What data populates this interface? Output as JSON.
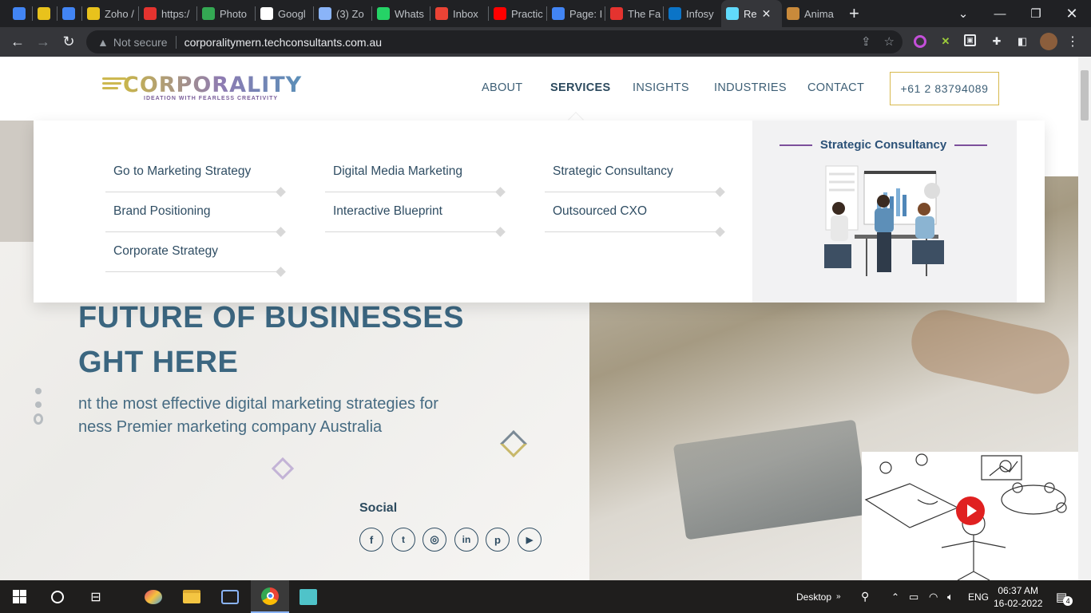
{
  "browser": {
    "tabs": [
      {
        "label": "",
        "icon": "google-translate-icon",
        "color": "#4285f4"
      },
      {
        "label": "",
        "icon": "cube-icon",
        "color": "#e8c21c"
      },
      {
        "label": "",
        "icon": "docs-icon",
        "color": "#4285f4"
      },
      {
        "label": "Zoho /",
        "icon": "zoho-icon",
        "color": "#e8c21c"
      },
      {
        "label": "https:/",
        "icon": "z-icon",
        "color": "#e4332f"
      },
      {
        "label": "Photo",
        "icon": "drive-icon",
        "color": "#34a853"
      },
      {
        "label": "Googl",
        "icon": "google-icon",
        "color": "#ffffff"
      },
      {
        "label": "(3) Zo",
        "icon": "zoho-people-icon",
        "color": "#8ab4f8"
      },
      {
        "label": "Whats",
        "icon": "whatsapp-icon",
        "color": "#25d366"
      },
      {
        "label": "Inbox",
        "icon": "gmail-icon",
        "color": "#ea4335"
      },
      {
        "label": "Practic",
        "icon": "youtube-icon",
        "color": "#ff0000"
      },
      {
        "label": "Page: I",
        "icon": "docs-icon",
        "color": "#4285f4"
      },
      {
        "label": "The Fa",
        "icon": "clock-icon",
        "color": "#e4332f"
      },
      {
        "label": "Infosy",
        "icon": "infosys-icon",
        "color": "#0b74c7"
      },
      {
        "label": "Re",
        "icon": "react-icon",
        "color": "#61dafb",
        "active": true
      },
      {
        "label": "Anima",
        "icon": "book-icon",
        "color": "#c98a3b"
      }
    ],
    "not_secure": "Not secure",
    "url": "corporalitymern.techconsultants.com.au"
  },
  "site": {
    "logo": {
      "word": "CORPORALITY",
      "tagline": "IDEATION WITH FEARLESS CREATIVITY"
    },
    "nav": [
      "ABOUT",
      "SERVICES",
      "INSIGHTS",
      "INDUSTRIES",
      "CONTACT"
    ],
    "active_nav": "SERVICES",
    "phone": "+61 2 83794089"
  },
  "mega_menu": {
    "columns": [
      [
        "Go to Marketing Strategy",
        "Brand Positioning",
        "Corporate Strategy"
      ],
      [
        "Digital Media Marketing",
        "Interactive Blueprint"
      ],
      [
        "Strategic Consultancy",
        "Outsourced CXO"
      ]
    ],
    "side_title": "Strategic Consultancy"
  },
  "hero": {
    "heading_line1": "FUTURE OF BUSINESSES",
    "heading_line2": "GHT HERE",
    "text_line1": "nt the most effective digital marketing strategies for",
    "text_line2": "ness Premier marketing company Australia"
  },
  "social": {
    "title": "Social",
    "icons": [
      "facebook-icon",
      "twitter-icon",
      "instagram-icon",
      "linkedin-icon",
      "pinterest-icon",
      "youtube-icon"
    ]
  },
  "taskbar": {
    "desktop_label": "Desktop",
    "lang": "ENG",
    "time": "06:37 AM",
    "date": "16-02-2022",
    "notif_count": "4"
  }
}
